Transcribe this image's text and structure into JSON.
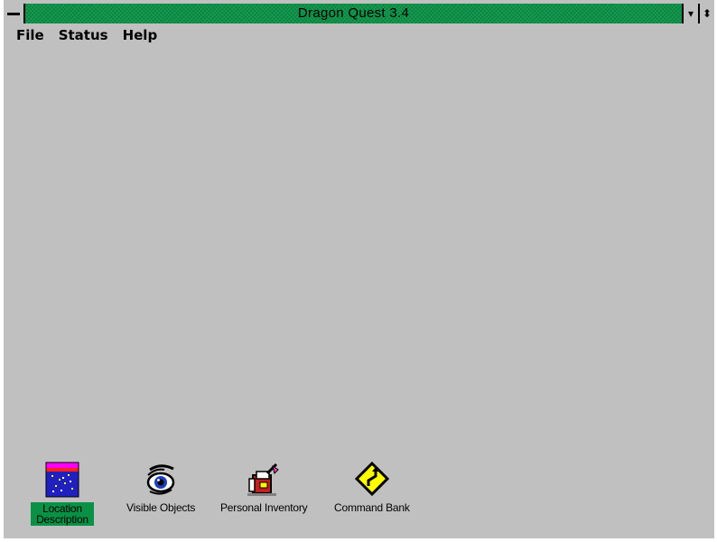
{
  "window": {
    "title": "Dragon Quest 3.4"
  },
  "menu": {
    "file": "File",
    "status": "Status",
    "help": "Help"
  },
  "icons": [
    {
      "label": "Location Description",
      "icon": "location-icon",
      "selected": true
    },
    {
      "label": "Visible Objects",
      "icon": "eye-icon",
      "selected": false
    },
    {
      "label": "Personal Inventory",
      "icon": "backpack-icon",
      "selected": false
    },
    {
      "label": "Command Bank",
      "icon": "road-sign-icon",
      "selected": false
    }
  ],
  "colors": {
    "title_bar": "#0a9146",
    "workspace": "#c0c0c0",
    "selection": "#0a9146"
  }
}
